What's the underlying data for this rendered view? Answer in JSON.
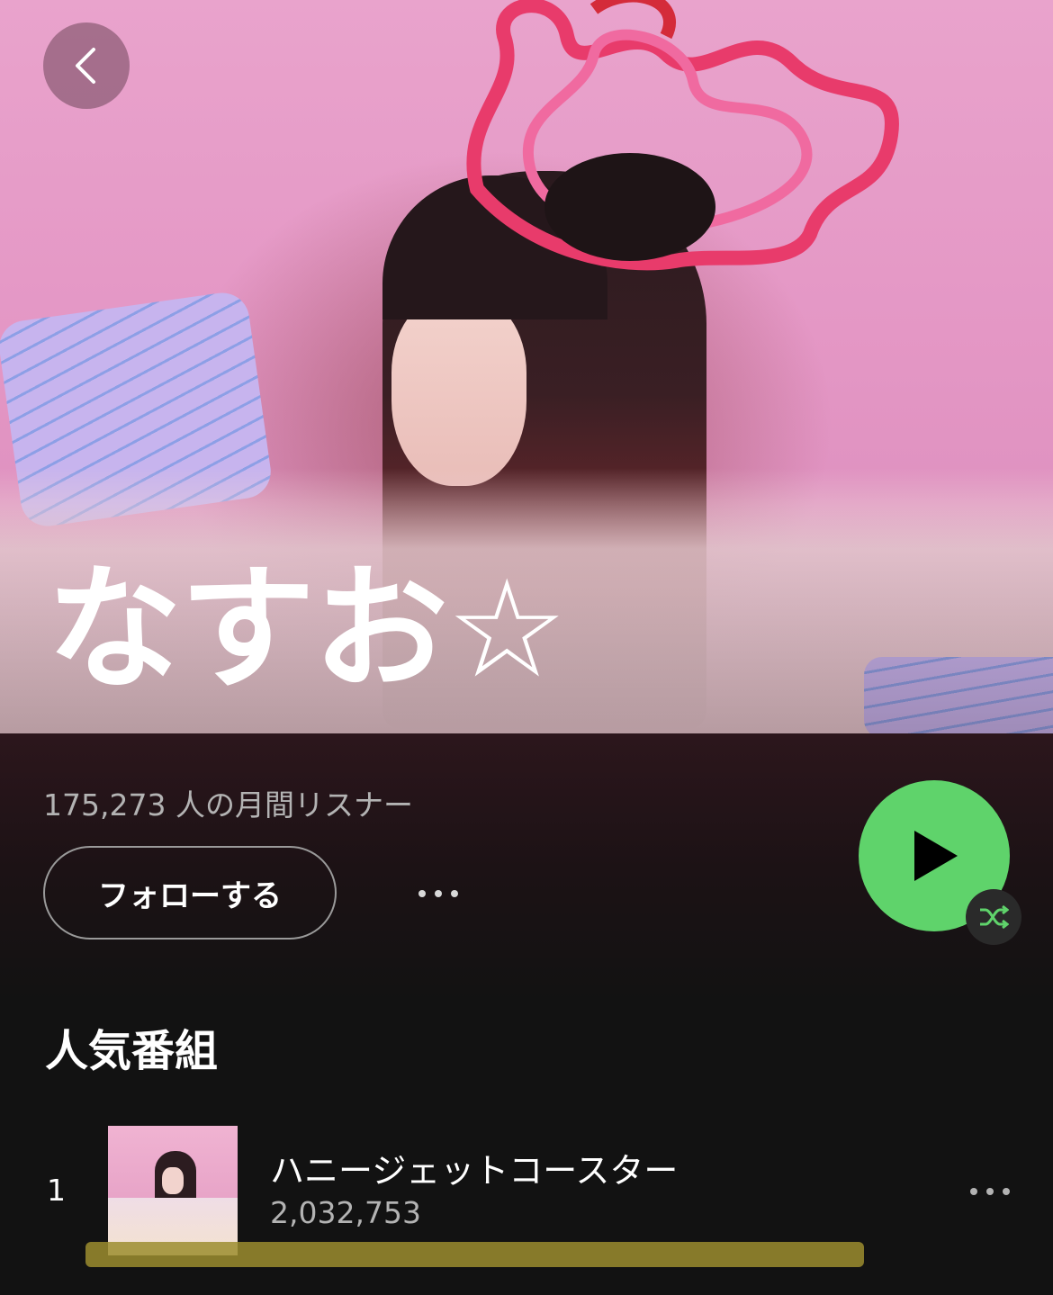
{
  "artist": {
    "name": "なすお☆",
    "monthly_listeners": "175,273 人の月間リスナー"
  },
  "actions": {
    "follow_label": "フォローする"
  },
  "popular": {
    "section_title": "人気番組",
    "tracks": [
      {
        "index": "1",
        "title": "ハニージェットコースター",
        "plays": "2,032,753"
      }
    ]
  },
  "colors": {
    "background": "#121212",
    "play_button": "#5fd36b",
    "text_primary": "#ffffff",
    "text_secondary": "#b3b3b3"
  },
  "icons": {
    "back": "chevron-left-icon",
    "more": "more-horizontal-icon",
    "play": "play-icon",
    "shuffle": "shuffle-icon"
  }
}
